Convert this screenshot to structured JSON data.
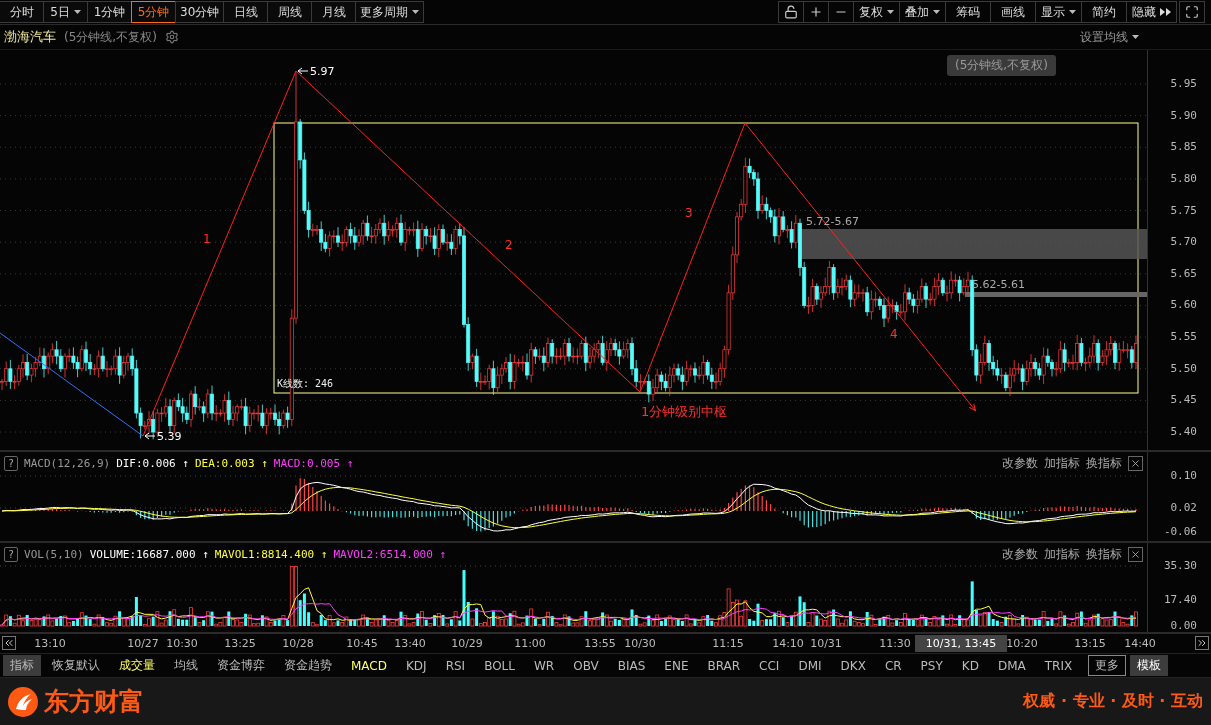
{
  "period_tabs": [
    {
      "label": "分时",
      "selected": false,
      "dropdown": false
    },
    {
      "label": "5日",
      "selected": false,
      "dropdown": true
    },
    {
      "label": "1分钟",
      "selected": false,
      "dropdown": false
    },
    {
      "label": "5分钟",
      "selected": true,
      "dropdown": false
    },
    {
      "label": "30分钟",
      "selected": false,
      "dropdown": false
    },
    {
      "label": "日线",
      "selected": false,
      "dropdown": false
    },
    {
      "label": "周线",
      "selected": false,
      "dropdown": false
    },
    {
      "label": "月线",
      "selected": false,
      "dropdown": false
    },
    {
      "label": "更多周期",
      "selected": false,
      "dropdown": true
    }
  ],
  "toolbar": [
    {
      "label": "复权",
      "dropdown": true
    },
    {
      "label": "叠加",
      "dropdown": true
    },
    {
      "label": "筹码",
      "dropdown": false
    },
    {
      "label": "画线",
      "dropdown": false
    },
    {
      "label": "显示",
      "dropdown": true
    },
    {
      "label": "简约",
      "dropdown": false
    },
    {
      "label": "隐藏",
      "dropdown": false
    }
  ],
  "stock": {
    "name": "渤海汽车",
    "period_note": "(5分钟线,不复权)",
    "ma_settings": "设置均线"
  },
  "main_chart": {
    "price_ticks": [
      "5.95",
      "5.90",
      "5.85",
      "5.80",
      "5.75",
      "5.70",
      "5.65",
      "5.60",
      "5.55",
      "5.50",
      "5.45",
      "5.40"
    ],
    "tooltip": "(5分钟线,不复权)",
    "high_label": "5.97",
    "low_label": "5.39",
    "zone_labels": [
      "5.72-5.67",
      "5.62-5.61"
    ],
    "stroke_labels": [
      "1",
      "2",
      "3",
      "4"
    ],
    "pivot_label": "1分钟级别中枢",
    "bar_count": "K线数: 246"
  },
  "macd": {
    "help": "?",
    "name": "MACD(12,26,9)",
    "values": [
      {
        "label": "DIF:0.006",
        "arrow": "↑",
        "color": "#ffffff"
      },
      {
        "label": "DEA:0.003",
        "arrow": "↑",
        "color": "#ffff3c"
      },
      {
        "label": "MACD:0.005",
        "arrow": "↑",
        "color": "#ff3cff"
      }
    ],
    "actions": [
      "改参数",
      "加指标",
      "换指标"
    ],
    "ticks": [
      "0.10",
      "0.02",
      "-0.06"
    ]
  },
  "vol": {
    "help": "?",
    "name": "VOL(5,10)",
    "values": [
      {
        "label": "VOLUME:16687.000",
        "arrow": "↑",
        "color": "#ffffff"
      },
      {
        "label": "MAVOL1:8814.400",
        "arrow": "↑",
        "color": "#ffff3c"
      },
      {
        "label": "MAVOL2:6514.000",
        "arrow": "↑",
        "color": "#ff3cff"
      }
    ],
    "actions": [
      "改参数",
      "加指标",
      "换指标"
    ],
    "ticks": [
      "35.30",
      "17.40",
      "0.00"
    ]
  },
  "x_axis": {
    "labels": [
      "13:10",
      "10/27",
      "10:30",
      "13:25",
      "10/28",
      "10:45",
      "13:40",
      "10/29",
      "11:00",
      "13:55",
      "10/30",
      "11:15",
      "14:10",
      "10/31",
      "11:30",
      "10:20",
      "13:15",
      "14:40"
    ],
    "cursor_label": "10/31, 13:45"
  },
  "indicator_tabs": [
    {
      "label": "指标",
      "kind": "header",
      "selected": false
    },
    {
      "label": "恢复默认",
      "kind": "tab",
      "selected": false
    },
    {
      "label": "成交量",
      "kind": "tab",
      "selected": true
    },
    {
      "label": "均线",
      "kind": "tab",
      "selected": false
    },
    {
      "label": "资金博弈",
      "kind": "tab",
      "selected": false
    },
    {
      "label": "资金趋势",
      "kind": "tab",
      "selected": false
    },
    {
      "label": "MACD",
      "kind": "tab",
      "selected": true
    },
    {
      "label": "KDJ",
      "kind": "tab",
      "selected": false
    },
    {
      "label": "RSI",
      "kind": "tab",
      "selected": false
    },
    {
      "label": "BOLL",
      "kind": "tab",
      "selected": false
    },
    {
      "label": "WR",
      "kind": "tab",
      "selected": false
    },
    {
      "label": "OBV",
      "kind": "tab",
      "selected": false
    },
    {
      "label": "BIAS",
      "kind": "tab",
      "selected": false
    },
    {
      "label": "ENE",
      "kind": "tab",
      "selected": false
    },
    {
      "label": "BRAR",
      "kind": "tab",
      "selected": false
    },
    {
      "label": "CCI",
      "kind": "tab",
      "selected": false
    },
    {
      "label": "DMI",
      "kind": "tab",
      "selected": false
    },
    {
      "label": "DKX",
      "kind": "tab",
      "selected": false
    },
    {
      "label": "CR",
      "kind": "tab",
      "selected": false
    },
    {
      "label": "PSY",
      "kind": "tab",
      "selected": false
    },
    {
      "label": "KD",
      "kind": "tab",
      "selected": false
    },
    {
      "label": "DMA",
      "kind": "tab",
      "selected": false
    },
    {
      "label": "TRIX",
      "kind": "tab",
      "selected": false
    },
    {
      "label": "更多",
      "kind": "more",
      "selected": false
    },
    {
      "label": "模板",
      "kind": "template",
      "selected": false
    }
  ],
  "footer": {
    "brand": "东方财富",
    "slogan": "权威 · 专业 · 及时 · 互动"
  }
}
